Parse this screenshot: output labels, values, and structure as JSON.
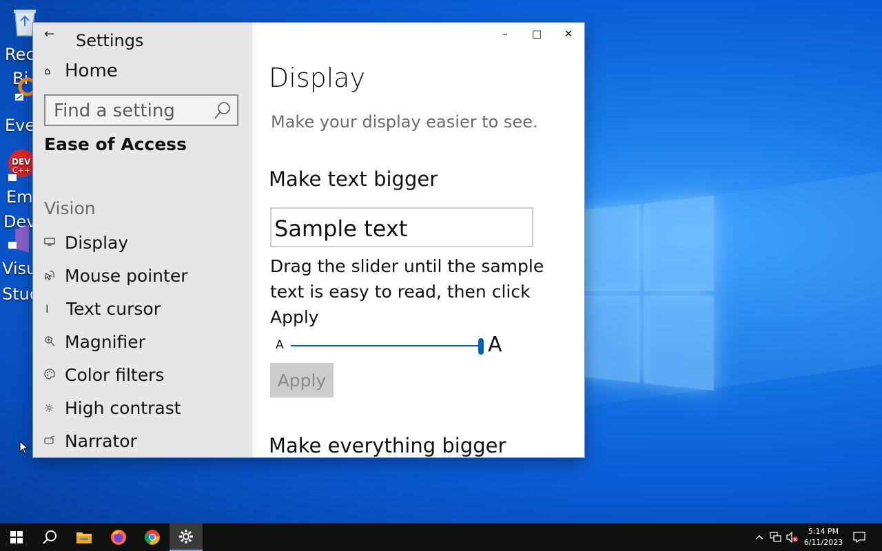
{
  "desktop": {
    "icons": [
      {
        "name": "recycle-bin",
        "label": "Rec",
        "label2": "Bi"
      },
      {
        "name": "everything",
        "label": "Eve"
      },
      {
        "name": "embarcadero-dev-cpp",
        "label": "Em",
        "label2": "Dev"
      },
      {
        "name": "visual-studio",
        "label": "Visu",
        "label2": "Stud"
      }
    ]
  },
  "window": {
    "title": "Settings",
    "controls": {
      "minimize": "–",
      "maximize": "□",
      "close": "✕"
    },
    "sidebar": {
      "home_label": "Home",
      "search_placeholder": "Find a setting",
      "category": "Ease of Access",
      "section": "Vision",
      "items": [
        {
          "label": "Display",
          "icon": "monitor-icon"
        },
        {
          "label": "Mouse pointer",
          "icon": "mouse-pointer-icon"
        },
        {
          "label": "Text cursor",
          "icon": "text-cursor-icon"
        },
        {
          "label": "Magnifier",
          "icon": "magnifier-icon"
        },
        {
          "label": "Color filters",
          "icon": "palette-icon"
        },
        {
          "label": "High contrast",
          "icon": "sun-icon"
        },
        {
          "label": "Narrator",
          "icon": "narrator-icon"
        }
      ]
    },
    "content": {
      "title": "Display",
      "subtitle": "Make your display easier to see.",
      "text_bigger_heading": "Make text bigger",
      "sample_text": "Sample text",
      "instructions": "Drag the slider until the sample text is easy to read, then click Apply",
      "slider_min_label": "A",
      "slider_max_label": "A",
      "slider_value_fraction": 1.0,
      "apply_label": "Apply",
      "everything_bigger_heading": "Make everything bigger"
    }
  },
  "taskbar": {
    "apps": [
      "start-icon",
      "search-icon",
      "file-explorer-icon",
      "firefox-icon",
      "chrome-icon",
      "settings-icon"
    ],
    "active_app": "settings-icon",
    "time": "5:14 PM",
    "date": "6/11/2023"
  },
  "colors": {
    "accent": "#0063b1",
    "sidebar_bg": "#e6e6e6",
    "taskbar_bg": "#101010"
  }
}
